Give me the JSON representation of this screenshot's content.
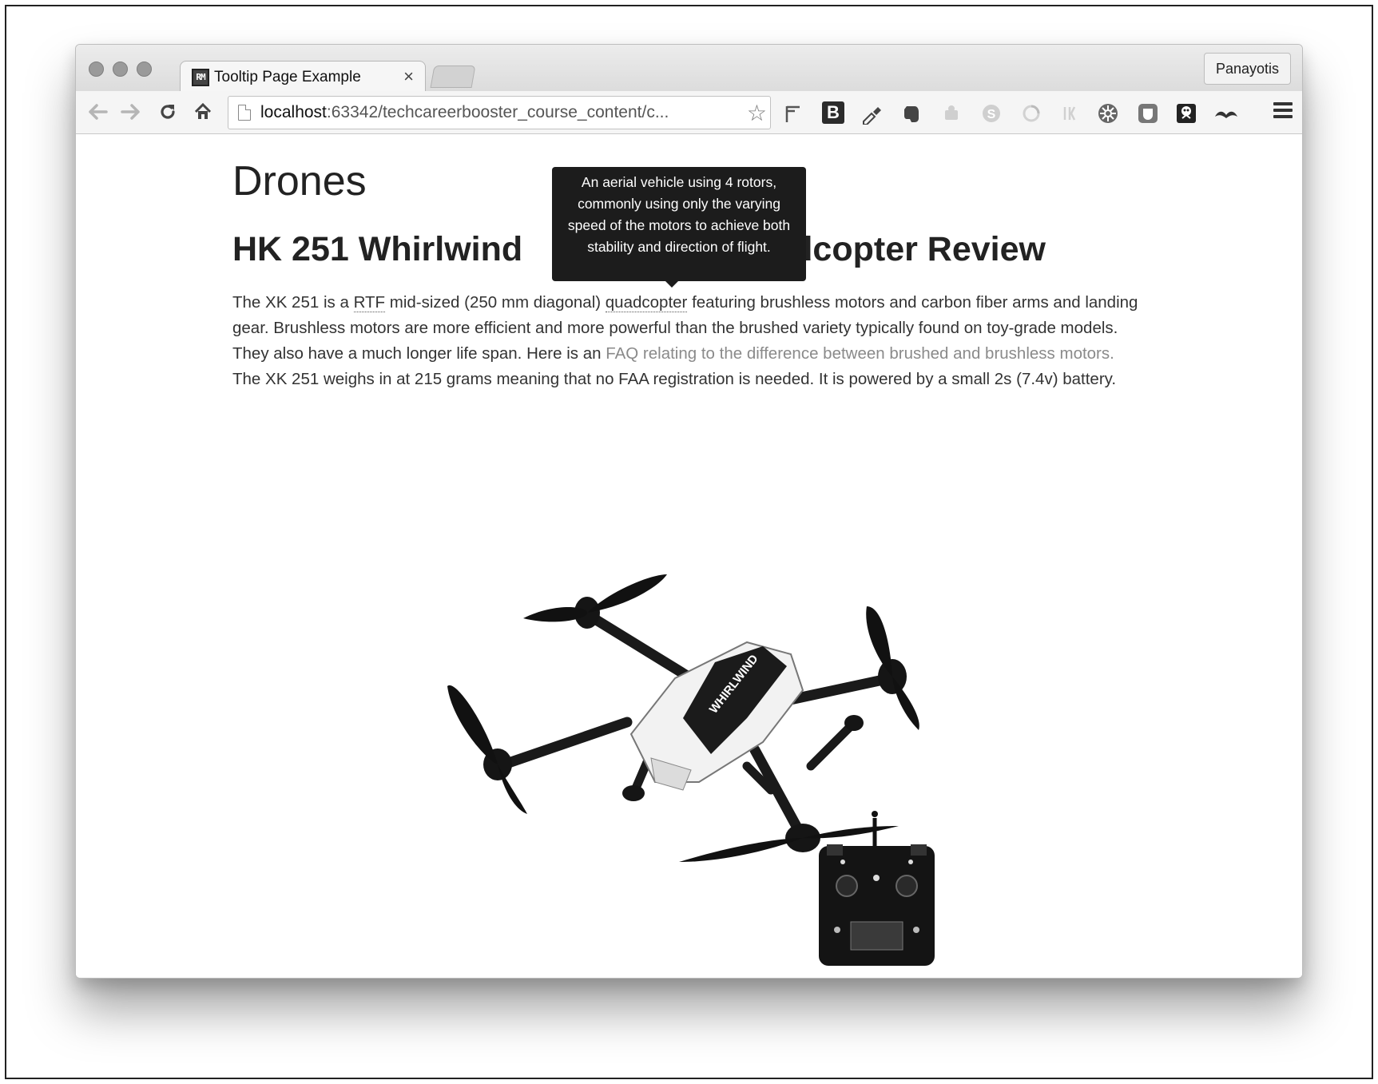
{
  "window": {
    "tab_title": "Tooltip Page Example",
    "tab_close": "×",
    "favicon_text": "RM",
    "profile_name": "Panayotis"
  },
  "toolbar": {
    "url_host": "localhost",
    "url_rest": ":63342/techcareerbooster_course_content/c...",
    "back_icon": "back-arrow-icon",
    "forward_icon": "forward-arrow-icon",
    "reload_icon": "reload-icon",
    "home_icon": "home-icon",
    "bookmark_icon": "star-icon",
    "ext_b_label": "B",
    "ext_s_label": "S"
  },
  "page": {
    "heading": "Drones",
    "subheading_left": "HK 251 Whirlwind",
    "subheading_right": "dcopter Review",
    "para_1": "The XK 251 is a ",
    "abbr_rtf": "RTF",
    "para_2": " mid-sized (250 mm diagonal) ",
    "abbr_quad": "quadcopter",
    "para_3": " featuring brushless motors and carbon fiber arms and landing gear. Brushless motors are more efficient and more powerful than the brushed variety typically found on toy-grade models. They also have a much longer life span. Here is an ",
    "link_text": "FAQ relating to the difference between brushed and brushless motors.",
    "para_4": " The XK 251 weighs in at 215 grams meaning that no FAA registration is needed. It is powered by a small 2s (7.4v) battery."
  },
  "tooltip": {
    "text": "An aerial vehicle using 4 rotors, commonly using only the varying speed of the motors to achieve both stability and direction of flight."
  },
  "image": {
    "drone_text": "WHIRLWIND"
  }
}
